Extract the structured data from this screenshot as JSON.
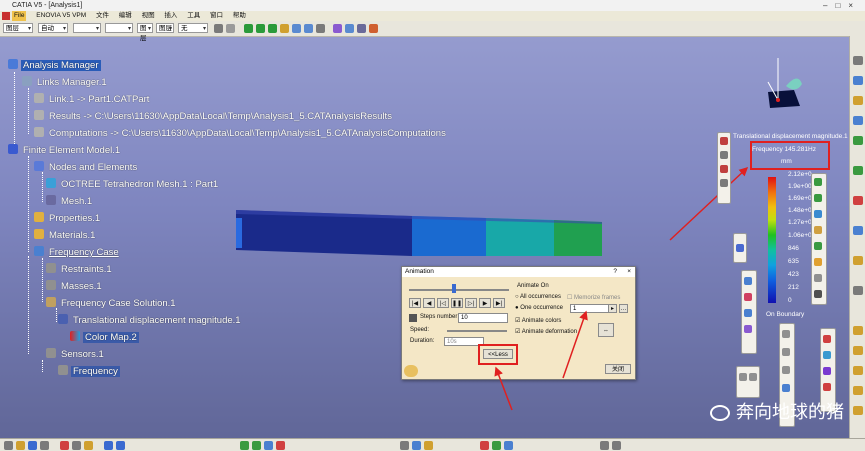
{
  "window": {
    "title": "CATIA V5 - [Analysis1]"
  },
  "menu": {
    "items": [
      "File",
      "ENOVIA V5 VPM",
      "文件",
      "编辑",
      "视图",
      "插入",
      "工具",
      "窗口",
      "帮助"
    ]
  },
  "toolbar": {
    "combos": [
      "图层",
      "自动",
      "",
      "",
      "图层",
      "图层",
      "无"
    ]
  },
  "tree": {
    "root": "Analysis Manager",
    "links_manager": "Links Manager.1",
    "link": "Link.1 -> Part1.CATPart",
    "results": "Results -> C:\\Users\\11630\\AppData\\Local\\Temp\\Analysis1_5.CATAnalysisResults",
    "computations": "Computations -> C:\\Users\\11630\\AppData\\Local\\Temp\\Analysis1_5.CATAnalysisComputations",
    "fem": "Finite Element Model.1",
    "nodes": "Nodes and Elements",
    "mesh_octree": "OCTREE Tetrahedron Mesh.1 : Part1",
    "mesh": "Mesh.1",
    "properties": "Properties.1",
    "materials": "Materials.1",
    "freq_case": "Frequency Case",
    "restraints": "Restraints.1",
    "masses": "Masses.1",
    "solution": "Frequency Case Solution.1",
    "translational": "Translational displacement magnitude.1",
    "colormap": "Color Map.2",
    "sensors": "Sensors.1",
    "frequency": "Frequency"
  },
  "legend": {
    "title": "Translational displacement magnitude.1",
    "frequency": "Frequency 145.281Hz",
    "unit": "mm",
    "ticks": [
      "2.12e+0",
      "1.9e+00",
      "1.69e+0",
      "1.48e+0",
      "1.27e+0",
      "1.06e+0",
      "846",
      "635",
      "423",
      "212",
      "0"
    ],
    "boundary": "On Boundary"
  },
  "dialog": {
    "title": "Animation",
    "help": "?",
    "close_x": "×",
    "steps_label": "Steps number",
    "steps_value": "10",
    "speed_label": "Speed:",
    "duration_label": "Duration:",
    "duration_value": "10s",
    "animate_on": "Animate On",
    "all_occurrences": "All occurrences",
    "memorize": "Memorize frames",
    "one_occurrence": "One occurrence",
    "occurrence_value": "1",
    "animate_colors": "Animate colors",
    "animate_deformation": "Animate deformation",
    "less_button": "<<Less",
    "close_button": "关闭"
  },
  "colors": {
    "highlight": "#2a5cb8",
    "annotation": "#e02020",
    "dialog": "#f4e7c6"
  },
  "watermark": "奔向地球的猪"
}
